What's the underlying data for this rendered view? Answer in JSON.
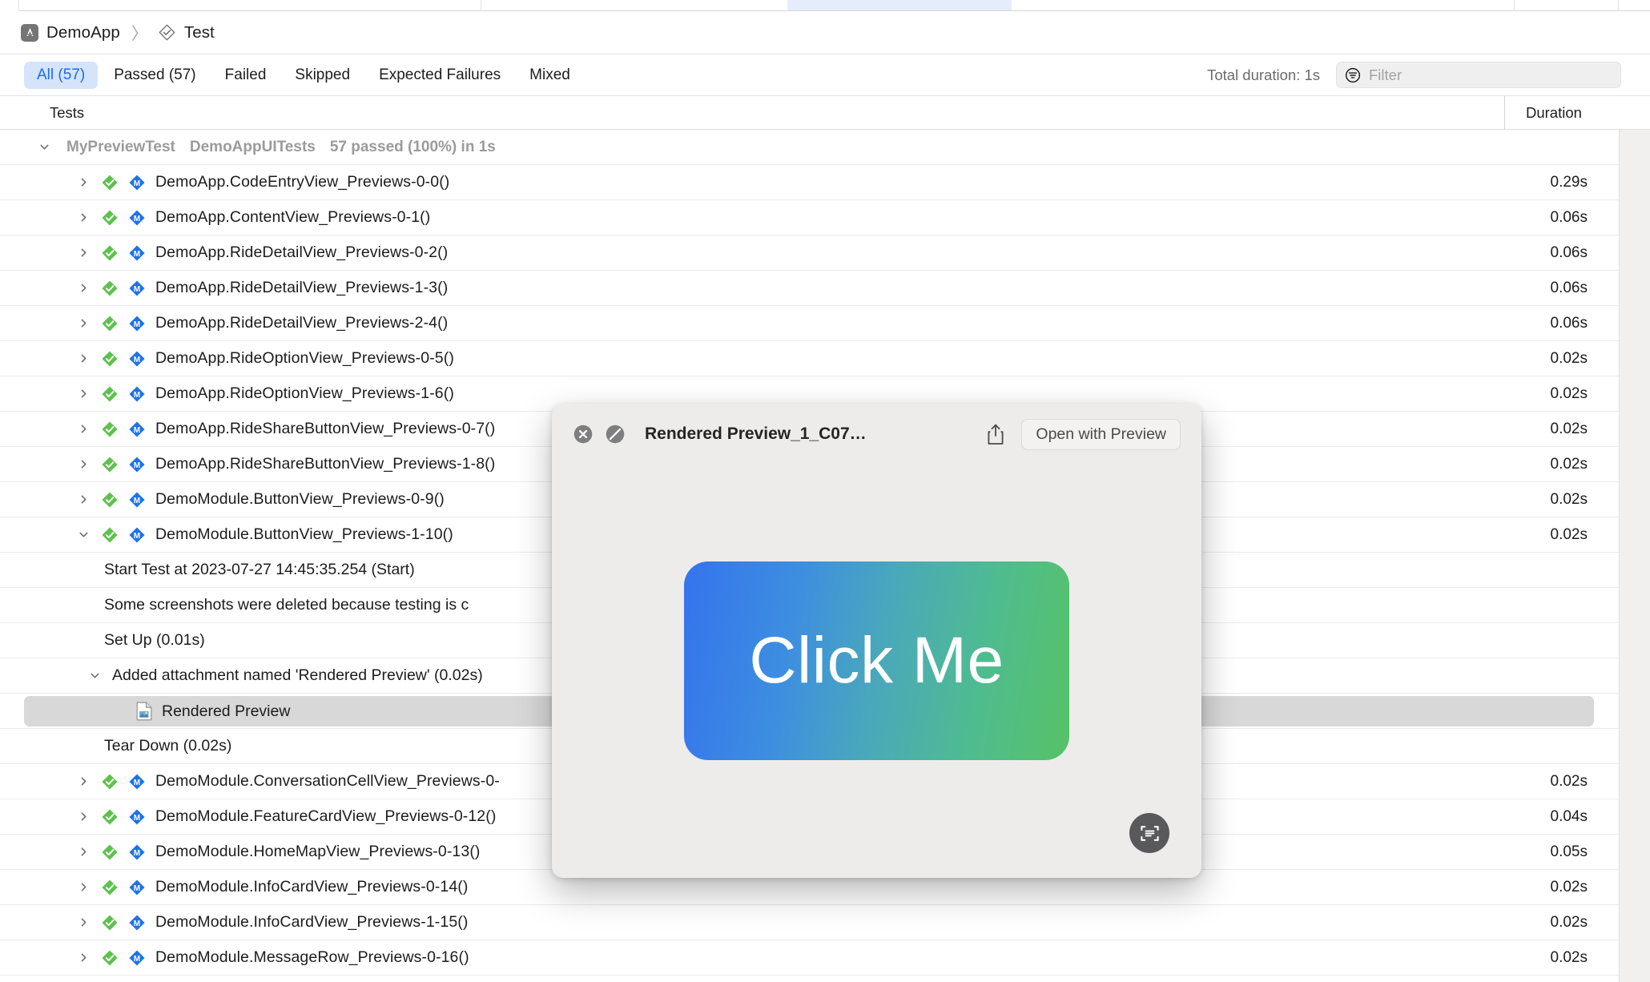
{
  "window": {
    "tab_strip": {
      "active_tab_highlight_color": "#e5edfb"
    }
  },
  "breadcrumb": {
    "project": "DemoApp",
    "separator": "〉",
    "section": "Test",
    "project_icon": "appstore-icon",
    "section_icon": "test-diamond-icon"
  },
  "filterbar": {
    "segments": [
      {
        "label": "All (57)",
        "active": true
      },
      {
        "label": "Passed (57)",
        "active": false
      },
      {
        "label": "Failed",
        "active": false
      },
      {
        "label": "Skipped",
        "active": false
      },
      {
        "label": "Expected Failures",
        "active": false
      },
      {
        "label": "Mixed",
        "active": false
      }
    ],
    "total_duration": "Total duration: 1s",
    "filter_placeholder": "Filter",
    "filter_icon": "filter-icon",
    "active_color": "#1b6cf2",
    "active_bg": "#d5e4fb"
  },
  "table": {
    "columns": {
      "tests": "Tests",
      "duration": "Duration"
    },
    "group": {
      "name": "MyPreviewTest",
      "target": "DemoAppUITests",
      "summary": "57 passed (100%) in 1s",
      "expanded": true
    },
    "rows": [
      {
        "kind": "test",
        "name": "DemoApp.CodeEntryView_Previews-0-0()",
        "duration": "0.29s",
        "expanded": false,
        "status": "passed"
      },
      {
        "kind": "test",
        "name": "DemoApp.ContentView_Previews-0-1()",
        "duration": "0.06s",
        "expanded": false,
        "status": "passed"
      },
      {
        "kind": "test",
        "name": "DemoApp.RideDetailView_Previews-0-2()",
        "duration": "0.06s",
        "expanded": false,
        "status": "passed"
      },
      {
        "kind": "test",
        "name": "DemoApp.RideDetailView_Previews-1-3()",
        "duration": "0.06s",
        "expanded": false,
        "status": "passed"
      },
      {
        "kind": "test",
        "name": "DemoApp.RideDetailView_Previews-2-4()",
        "duration": "0.06s",
        "expanded": false,
        "status": "passed"
      },
      {
        "kind": "test",
        "name": "DemoApp.RideOptionView_Previews-0-5()",
        "duration": "0.02s",
        "expanded": false,
        "status": "passed"
      },
      {
        "kind": "test",
        "name": "DemoApp.RideOptionView_Previews-1-6()",
        "duration": "0.02s",
        "expanded": false,
        "status": "passed"
      },
      {
        "kind": "test",
        "name": "DemoApp.RideShareButtonView_Previews-0-7()",
        "duration": "0.02s",
        "expanded": false,
        "status": "passed"
      },
      {
        "kind": "test",
        "name": "DemoApp.RideShareButtonView_Previews-1-8()",
        "duration": "0.02s",
        "expanded": false,
        "status": "passed"
      },
      {
        "kind": "test",
        "name": "DemoModule.ButtonView_Previews-0-9()",
        "duration": "0.02s",
        "expanded": false,
        "status": "passed"
      },
      {
        "kind": "test",
        "name": "DemoModule.ButtonView_Previews-1-10()",
        "duration": "0.02s",
        "expanded": true,
        "status": "passed"
      },
      {
        "kind": "activity",
        "name": "Start Test at 2023-07-27 14:45:35.254 (Start)",
        "duration": ""
      },
      {
        "kind": "activity",
        "name": "Some screenshots were deleted because testing is c",
        "duration": ""
      },
      {
        "kind": "activity",
        "name": "Set Up (0.01s)",
        "duration": ""
      },
      {
        "kind": "activity-expandable",
        "name": "Added attachment named 'Rendered Preview' (0.02s)",
        "duration": "",
        "expanded": true
      },
      {
        "kind": "attachment",
        "name": "Rendered Preview",
        "duration": "",
        "selected": true
      },
      {
        "kind": "activity",
        "name": "Tear Down (0.02s)",
        "duration": ""
      },
      {
        "kind": "test",
        "name": "DemoModule.ConversationCellView_Previews-0-",
        "duration": "0.02s",
        "expanded": false,
        "status": "passed"
      },
      {
        "kind": "test",
        "name": "DemoModule.FeatureCardView_Previews-0-12()",
        "duration": "0.04s",
        "expanded": false,
        "status": "passed"
      },
      {
        "kind": "test",
        "name": "DemoModule.HomeMapView_Previews-0-13()",
        "duration": "0.05s",
        "expanded": false,
        "status": "passed"
      },
      {
        "kind": "test",
        "name": "DemoModule.InfoCardView_Previews-0-14()",
        "duration": "0.02s",
        "expanded": false,
        "status": "passed"
      },
      {
        "kind": "test",
        "name": "DemoModule.InfoCardView_Previews-1-15()",
        "duration": "0.02s",
        "expanded": false,
        "status": "passed"
      },
      {
        "kind": "test",
        "name": "DemoModule.MessageRow_Previews-0-16()",
        "duration": "0.02s",
        "expanded": false,
        "status": "passed"
      }
    ]
  },
  "quicklook": {
    "title": "Rendered Preview_1_C07…",
    "close_icon": "close-circle-icon",
    "block_icon": "no-entry-icon",
    "share_icon": "share-icon",
    "open_button": "Open with Preview",
    "livetext_icon": "live-text-icon",
    "preview": {
      "button_label": "Click Me",
      "gradient_start": "#3573ee",
      "gradient_end": "#56c266",
      "text_color": "#ffffff"
    }
  }
}
